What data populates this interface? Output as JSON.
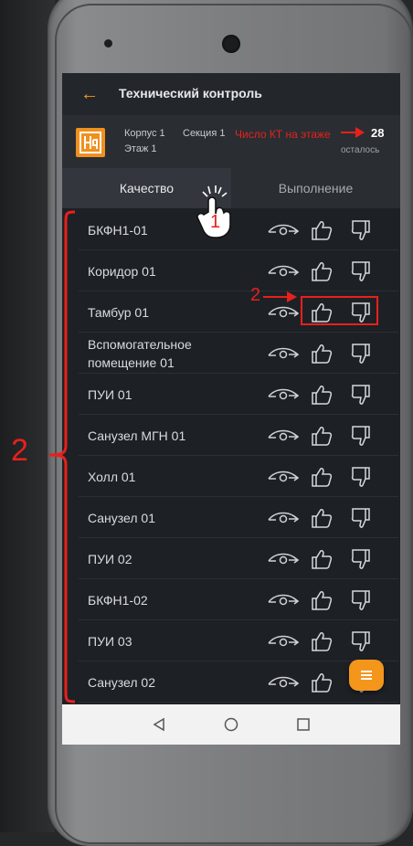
{
  "app": {
    "title": "Технический контроль",
    "back_icon": "back-arrow-icon",
    "accent": "#f39a1e"
  },
  "info": {
    "korpus": "Корпус 1",
    "sekciya": "Секция 1",
    "etazh": "Этаж 1",
    "kt_label": "Число КТ на этаже",
    "kt_count": "28",
    "kt_left": "осталось"
  },
  "tabs": [
    {
      "label": "Качество",
      "active": true
    },
    {
      "label": "Выполнение",
      "active": false
    }
  ],
  "items": [
    {
      "name": "БКФН1-01"
    },
    {
      "name": "Коридор 01"
    },
    {
      "name": "Тамбур 01"
    },
    {
      "name": "Вспомогательное помещение 01"
    },
    {
      "name": "ПУИ 01"
    },
    {
      "name": "Санузел МГН 01"
    },
    {
      "name": "Холл 01"
    },
    {
      "name": "Санузел 01"
    },
    {
      "name": "ПУИ 02"
    },
    {
      "name": "БКФН1-02"
    },
    {
      "name": "ПУИ 03"
    },
    {
      "name": "Санузел 02"
    }
  ],
  "annotations": {
    "tap_marker": "1",
    "row_marker": "2",
    "list_marker": "2",
    "color": "#e8201c"
  },
  "system_nav": [
    "back-triangle-icon",
    "home-circle-icon",
    "recents-square-icon"
  ],
  "fab_icon": "menu-icon"
}
